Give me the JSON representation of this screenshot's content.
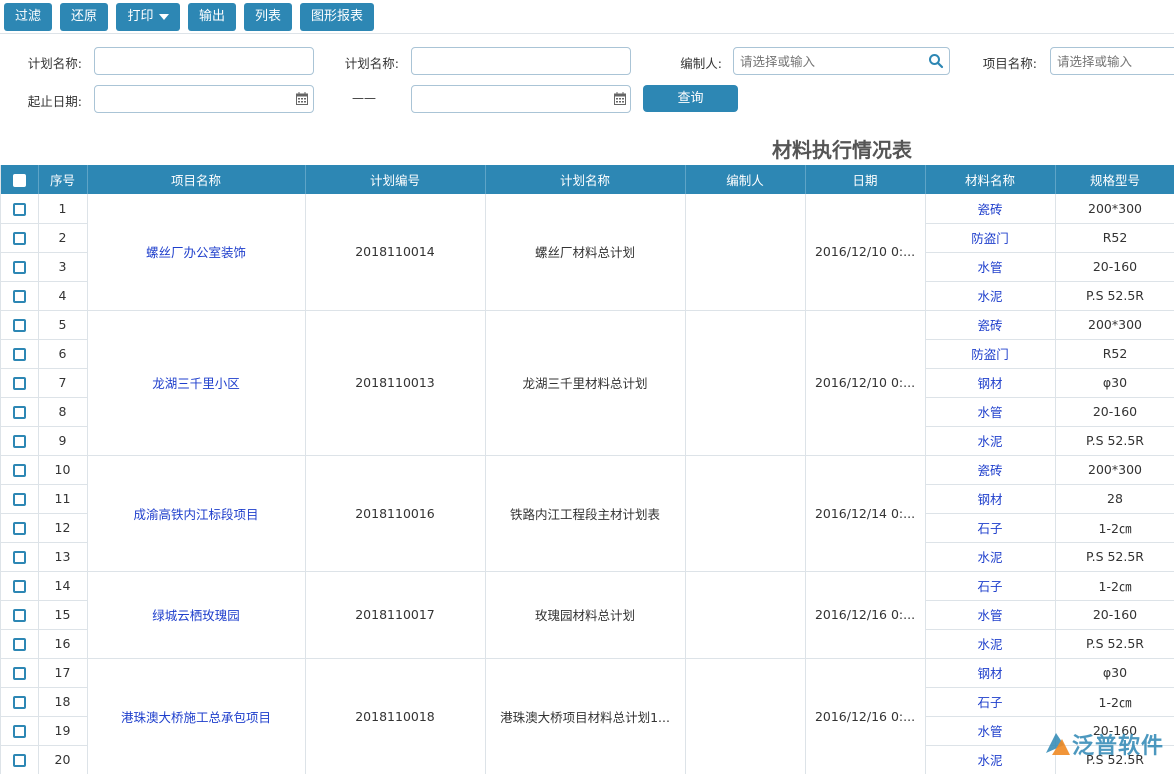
{
  "toolbar": {
    "filter": "过滤",
    "restore": "还原",
    "print": "打印",
    "export": "输出",
    "list": "列表",
    "chart_report": "图形报表"
  },
  "filters": {
    "plan_name_label_1": "计划名称:",
    "plan_name_value_1": "",
    "plan_name_label_2": "计划名称:",
    "plan_name_value_2": "",
    "creator_label": "编制人:",
    "creator_placeholder": "请选择或输入",
    "project_label": "项目名称:",
    "project_placeholder": "请选择或输入",
    "date_label": "起止日期:",
    "date_from": "",
    "date_sep": "——",
    "date_to": "",
    "query_button": "查询"
  },
  "report_title": "材料执行情况表",
  "columns": [
    "序号",
    "项目名称",
    "计划编号",
    "计划名称",
    "编制人",
    "日期",
    "材料名称",
    "规格型号"
  ],
  "groups": [
    {
      "project": "螺丝厂办公室装饰",
      "plan_no": "2018110014",
      "plan_name": "螺丝厂材料总计划",
      "creator": "",
      "date": "2016/12/10 0:...",
      "rows": [
        {
          "no": "1",
          "material": "瓷砖",
          "spec": "200*300"
        },
        {
          "no": "2",
          "material": "防盗门",
          "spec": "R52"
        },
        {
          "no": "3",
          "material": "水管",
          "spec": "20-160"
        },
        {
          "no": "4",
          "material": "水泥",
          "spec": "P.S 52.5R"
        }
      ]
    },
    {
      "project": "龙湖三千里小区",
      "plan_no": "2018110013",
      "plan_name": "龙湖三千里材料总计划",
      "creator": "",
      "date": "2016/12/10 0:...",
      "rows": [
        {
          "no": "5",
          "material": "瓷砖",
          "spec": "200*300"
        },
        {
          "no": "6",
          "material": "防盗门",
          "spec": "R52"
        },
        {
          "no": "7",
          "material": "钢材",
          "spec": "φ30"
        },
        {
          "no": "8",
          "material": "水管",
          "spec": "20-160"
        },
        {
          "no": "9",
          "material": "水泥",
          "spec": "P.S 52.5R"
        }
      ]
    },
    {
      "project": "成渝高铁内江标段项目",
      "plan_no": "2018110016",
      "plan_name": "铁路内江工程段主材计划表",
      "creator": "",
      "date": "2016/12/14 0:...",
      "rows": [
        {
          "no": "10",
          "material": "瓷砖",
          "spec": "200*300"
        },
        {
          "no": "11",
          "material": "钢材",
          "spec": "28"
        },
        {
          "no": "12",
          "material": "石子",
          "spec": "1-2㎝"
        },
        {
          "no": "13",
          "material": "水泥",
          "spec": "P.S 52.5R"
        }
      ]
    },
    {
      "project": "绿城云栖玫瑰园",
      "plan_no": "2018110017",
      "plan_name": "玫瑰园材料总计划",
      "creator": "",
      "date": "2016/12/16 0:...",
      "rows": [
        {
          "no": "14",
          "material": "石子",
          "spec": "1-2㎝"
        },
        {
          "no": "15",
          "material": "水管",
          "spec": "20-160"
        },
        {
          "no": "16",
          "material": "水泥",
          "spec": "P.S 52.5R"
        }
      ]
    },
    {
      "project": "港珠澳大桥施工总承包项目",
      "plan_no": "2018110018",
      "plan_name": "港珠澳大桥项目材料总计划1...",
      "creator": "",
      "date": "2016/12/16 0:...",
      "rows": [
        {
          "no": "17",
          "material": "钢材",
          "spec": "φ30"
        },
        {
          "no": "18",
          "material": "石子",
          "spec": "1-2㎝"
        },
        {
          "no": "19",
          "material": "水管",
          "spec": "20-160"
        },
        {
          "no": "20",
          "material": "水泥",
          "spec": "P.S 52.5R"
        }
      ]
    }
  ],
  "watermark": {
    "text": "泛普软件",
    "icons": [
      "fanpu-logo-icon"
    ]
  },
  "colors": {
    "accent": "#2d87b4",
    "link": "#1f3fcc",
    "border": "#dde3e8"
  }
}
